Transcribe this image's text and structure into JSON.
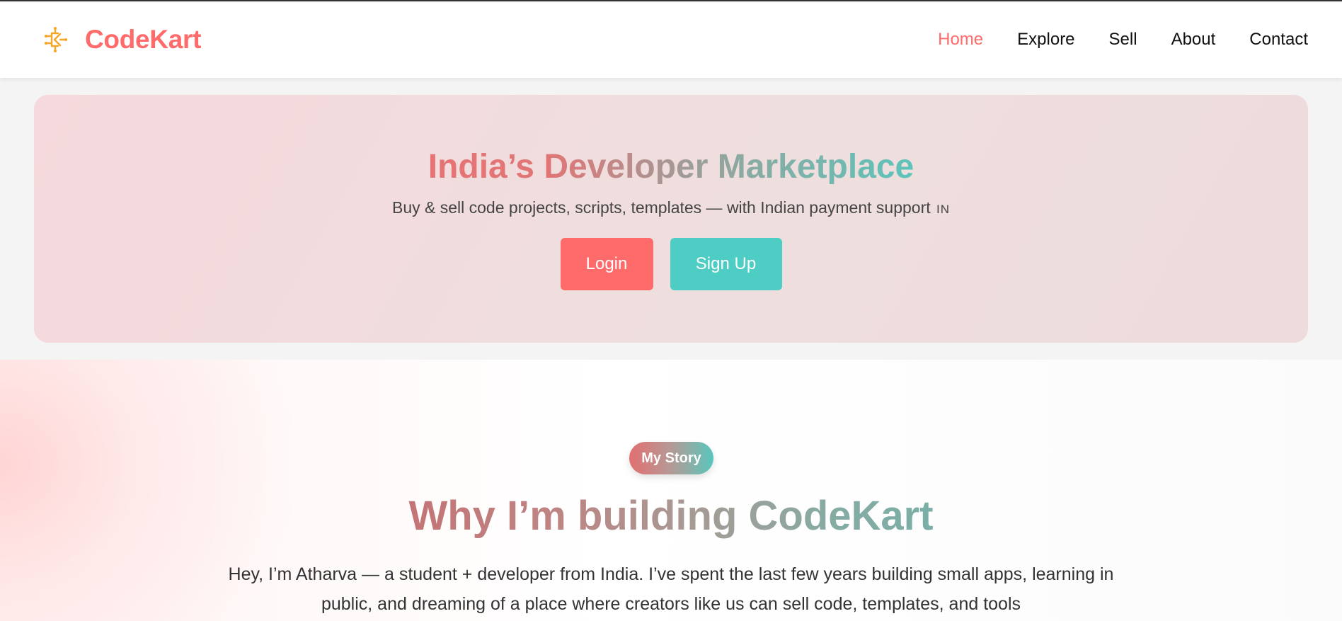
{
  "brand": {
    "name": "CodeKart",
    "logo_icon": "circuit-ck-logo-icon",
    "color": "#ff6b6b"
  },
  "nav": {
    "items": [
      {
        "label": "Home",
        "active": true
      },
      {
        "label": "Explore",
        "active": false
      },
      {
        "label": "Sell",
        "active": false
      },
      {
        "label": "About",
        "active": false
      },
      {
        "label": "Contact",
        "active": false
      }
    ]
  },
  "hero": {
    "title": "India’s Developer Marketplace",
    "subtitle": "Buy & sell code projects, scripts, templates — with Indian payment support",
    "flag": "IN",
    "login_label": "Login",
    "signup_label": "Sign Up"
  },
  "story": {
    "badge": "My Story",
    "title": "Why I’m building CodeKart",
    "text": "Hey, I’m Atharva — a student + developer from India. I’ve spent the last few years building small apps, learning in public, and dreaming of a place where creators like us can sell code, templates, and tools"
  },
  "colors": {
    "primary": "#ff6b6b",
    "secondary": "#4ecdc4",
    "logo": "#f5a623"
  }
}
